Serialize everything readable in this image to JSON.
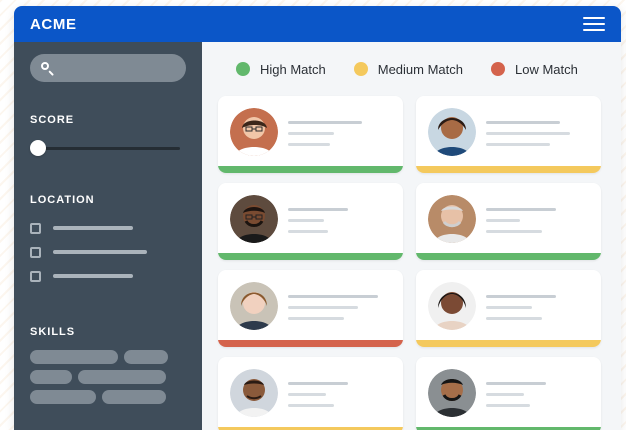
{
  "app": {
    "title": "ACME"
  },
  "icons": {
    "menu": "hamburger-menu-icon",
    "search": "search-icon"
  },
  "colors": {
    "topbar": "#0b56c8",
    "sidebar": "#3f4d5a",
    "high": "#62b86c",
    "medium": "#f4c95d",
    "low": "#d4634c"
  },
  "sidebar": {
    "search": {
      "value": ""
    },
    "score_label": "SCORE",
    "score_value_fraction": 0.0,
    "location_label": "LOCATION",
    "location_options": [
      {
        "checked": false
      },
      {
        "checked": false
      },
      {
        "checked": false
      }
    ],
    "skills_label": "SKILLS",
    "skills_chips": [
      {
        "kind": "chip"
      },
      {
        "kind": "chip"
      },
      {
        "kind": "chip"
      },
      {
        "kind": "chip"
      },
      {
        "kind": "chip"
      },
      {
        "kind": "chip"
      }
    ]
  },
  "legend": [
    {
      "label": "High Match",
      "color_key": "high"
    },
    {
      "label": "Medium Match",
      "color_key": "medium"
    },
    {
      "label": "Low Match",
      "color_key": "low"
    }
  ],
  "candidates": [
    {
      "match": "high"
    },
    {
      "match": "medium"
    },
    {
      "match": "high"
    },
    {
      "match": "high"
    },
    {
      "match": "low"
    },
    {
      "match": "medium"
    },
    {
      "match": "medium"
    },
    {
      "match": "high"
    }
  ]
}
